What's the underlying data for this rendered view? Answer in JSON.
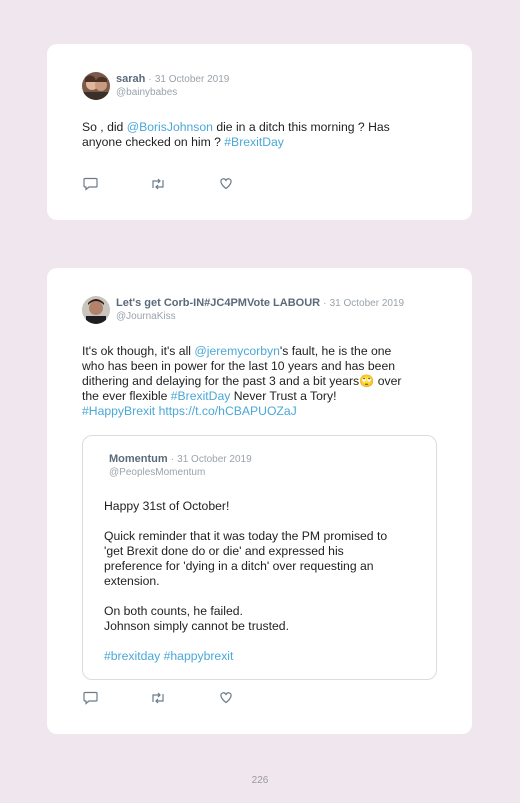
{
  "tweet1": {
    "name": "sarah",
    "separator": "·",
    "date": "31 October 2019",
    "handle": "@bainybabes",
    "body": {
      "part1": "So , did ",
      "mention": "@BorisJohnson",
      "part2": " die in a ditch this morning ? Has",
      "line2": "anyone checked on him ? ",
      "hashtag": "#BrexitDay"
    },
    "actions": [
      "reply-icon",
      "retweet-icon",
      "like-icon"
    ]
  },
  "tweet2": {
    "name": "Let's get Corb-IN#JC4PMVote LABOUR",
    "separator": "·",
    "date": "31 October 2019",
    "handle": "@JournaKiss",
    "body": {
      "l1a": "It's ok though, it's all ",
      "l1mention": "@jeremycorbyn",
      "l1b": "'s fault, he is the one",
      "l2": "who has been in power for the last 10 years and has been",
      "l3a": "dithering and delaying for the past 3 and a bit years",
      "l3emoji": "🙄",
      "l3b": " over",
      "l4a": "the ever flexible ",
      "l4hashtag": "#BrexitDay",
      "l4b": " Never Trust a Tory!",
      "l5hashtag": "#HappyBrexit",
      "l5space": " ",
      "l5link": "https://t.co/hCBAPUOZaJ"
    },
    "quote": {
      "name": "Momentum",
      "separator": "·",
      "date": "31 October 2019",
      "handle": "@PeoplesMomentum",
      "lines": [
        "Happy 31st of October!",
        "Quick reminder that it was today the PM promised to",
        "'get Brexit done do or die' and expressed his",
        "preference for 'dying in a ditch' over requesting an",
        "extension.",
        "On both counts, he failed.",
        "Johnson simply cannot be trusted."
      ],
      "hashtags": "#brexitday #happybrexit"
    },
    "actions": [
      "reply-icon",
      "retweet-icon",
      "like-icon"
    ]
  },
  "page": {
    "number": "226"
  },
  "colors": {
    "background": "#efe7ed",
    "card": "#ffffff",
    "link": "#4aa8d8",
    "name": "#5b6a7a",
    "meta": "#9aa3ab"
  }
}
